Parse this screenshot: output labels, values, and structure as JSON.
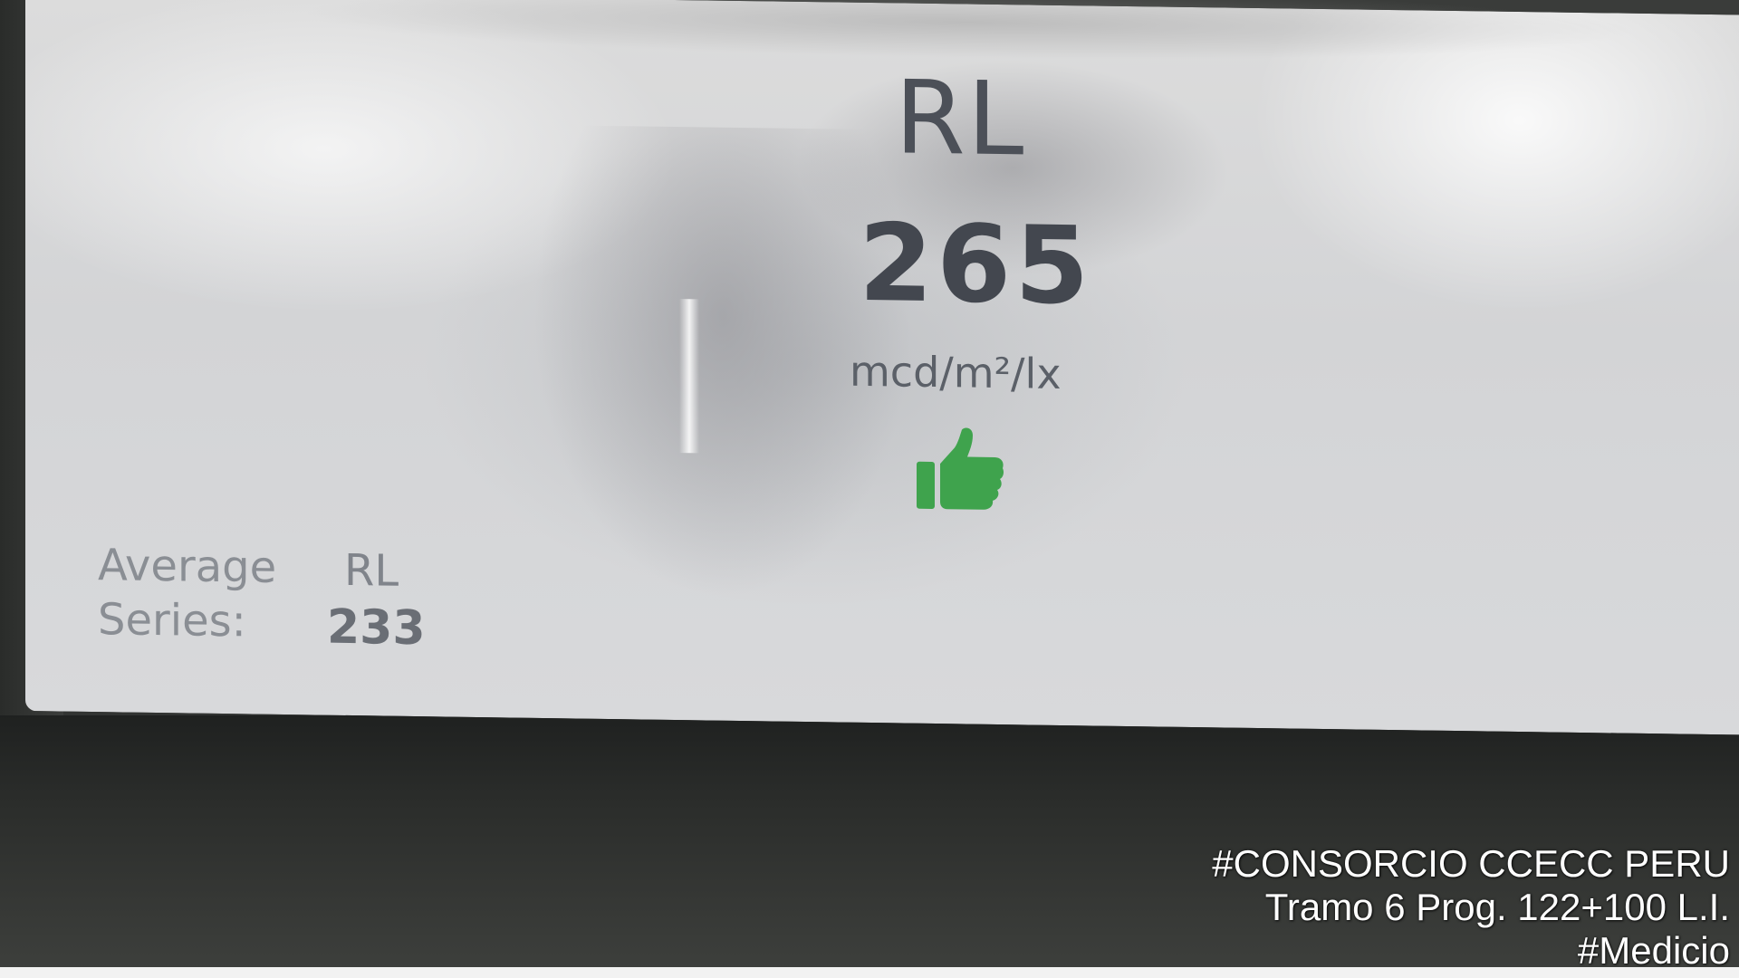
{
  "display": {
    "parameter": "RL",
    "value": "265",
    "unit": "mcd/m²/lx",
    "result_icon": "thumbs-up-icon",
    "result_color": "#3fa34d"
  },
  "average": {
    "label_line1": "Average",
    "label_line2": "Series:",
    "parameter": "RL",
    "value": "233"
  },
  "watermark": {
    "line1": "#CONSORCIO CCECC PERU",
    "line2": "Tramo 6 Prog. 122+100 L.I.",
    "line3": "#Medicio"
  }
}
